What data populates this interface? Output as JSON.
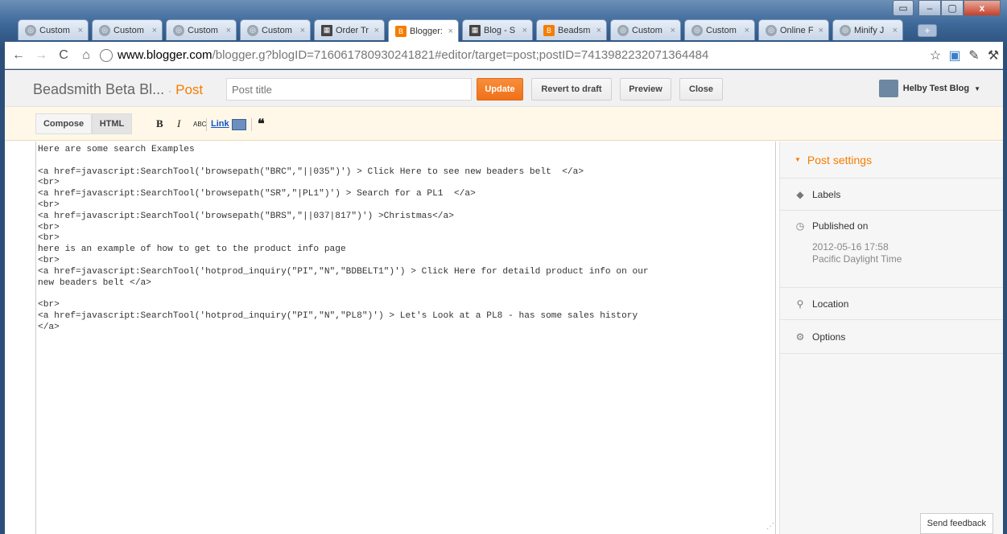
{
  "browser": {
    "tabs": [
      {
        "label": "Custom",
        "icon": "globe-icon"
      },
      {
        "label": "Custom",
        "icon": "globe-icon"
      },
      {
        "label": "Custom",
        "icon": "globe-icon"
      },
      {
        "label": "Custom",
        "icon": "globe-icon"
      },
      {
        "label": "Order Tr",
        "icon": "grid-icon"
      },
      {
        "label": "Blogger:",
        "icon": "blogger-icon",
        "active": true
      },
      {
        "label": "Blog - S",
        "icon": "grid-icon"
      },
      {
        "label": "Beadsm",
        "icon": "blogger-icon"
      },
      {
        "label": "Custom",
        "icon": "globe-icon"
      },
      {
        "label": "Custom",
        "icon": "globe-icon"
      },
      {
        "label": "Online F",
        "icon": "globe-icon"
      },
      {
        "label": "Minify J",
        "icon": "globe-icon"
      }
    ],
    "address": {
      "host": "www.blogger.com",
      "path": "/blogger.g?blogID=7160617809302418​21#editor/target=post;postID=7413982232071364484"
    }
  },
  "header": {
    "blog_name": "Beadsmith Beta Bl...",
    "separator": "·",
    "section": "Post",
    "title_placeholder": "Post title",
    "update_label": "Update",
    "revert_label": "Revert to draft",
    "preview_label": "Preview",
    "close_label": "Close",
    "profile_name": "Helby Test Blog"
  },
  "toolbar": {
    "compose_label": "Compose",
    "html_label": "HTML",
    "bold_label": "B",
    "italic_label": "I",
    "spell_label": "ABC",
    "link_label": "Link",
    "quote_label": "❝"
  },
  "editor": {
    "content": "Here are some search Examples\n\n<a href=javascript:SearchTool('browsepath(\"BRC\",\"||035\")') > Click Here to see new beaders belt  </a>\n<br>\n<a href=javascript:SearchTool('browsepath(\"SR\",\"|PL1\")') > Search for a PL1  </a>\n<br>\n<a href=javascript:SearchTool('browsepath(\"BRS\",\"||037|817\")') >Christmas</a>\n<br>\n<br>\nhere is an example of how to get to the product info page\n<br>\n<a href=javascript:SearchTool('hotprod_inquiry(\"PI\",\"N\",\"BDBELT1\")') > Click Here for detaild product info on our\nnew beaders belt </a>\n\n<br>\n<a href=javascript:SearchTool('hotprod_inquiry(\"PI\",\"N\",\"PL8\")') > Let's Look at a PL8 - has some sales history\n</a>"
  },
  "sidebar": {
    "post_settings": "Post settings",
    "labels": "Labels",
    "published_on": "Published on",
    "published_date": "2012-05-16 17:58",
    "published_tz": "Pacific Daylight Time",
    "location": "Location",
    "options": "Options"
  },
  "feedback_label": "Send feedback",
  "colors": {
    "accent": "#f57d00",
    "link": "#1155cc"
  }
}
